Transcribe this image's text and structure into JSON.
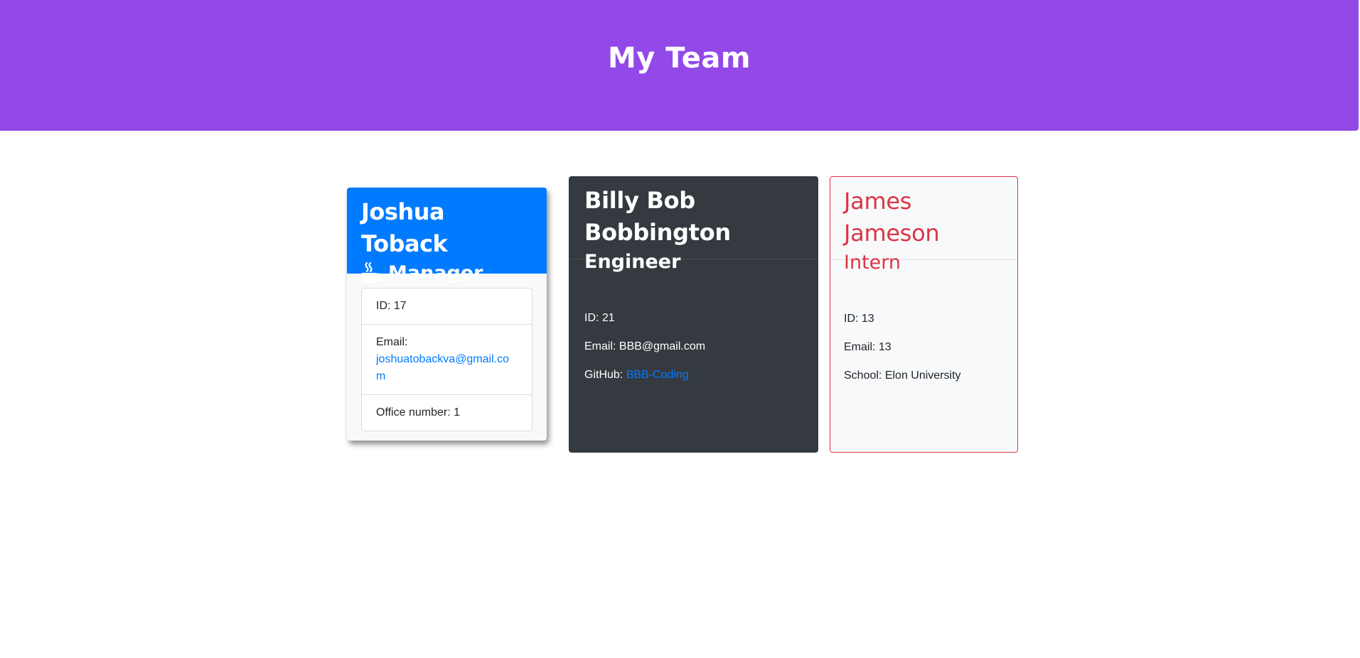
{
  "header": {
    "title": "My Team"
  },
  "manager": {
    "name": "Joshua Toback",
    "role": "Manager",
    "icon": "coffee-icon",
    "id": "ID: 17",
    "email_label": "Email:",
    "email": "joshuatobackva@gmail.com",
    "office": "Office number: 1"
  },
  "engineer": {
    "name": "Billy Bob Bobbington",
    "role": "Engineer",
    "id": "ID: 21",
    "email": "Email: BBB@gmail.com",
    "github_label": "GitHub:",
    "github": "BBB-Coding"
  },
  "intern": {
    "name": "James Jameson",
    "role": "Intern",
    "id": "ID: 13",
    "email": "Email: 13",
    "school": "School: Elon University"
  },
  "colors": {
    "header_bg": "#9349e8",
    "manager_header": "#007bff",
    "engineer_bg": "#343a40",
    "intern_accent": "#dc3545",
    "link": "#007bff"
  }
}
